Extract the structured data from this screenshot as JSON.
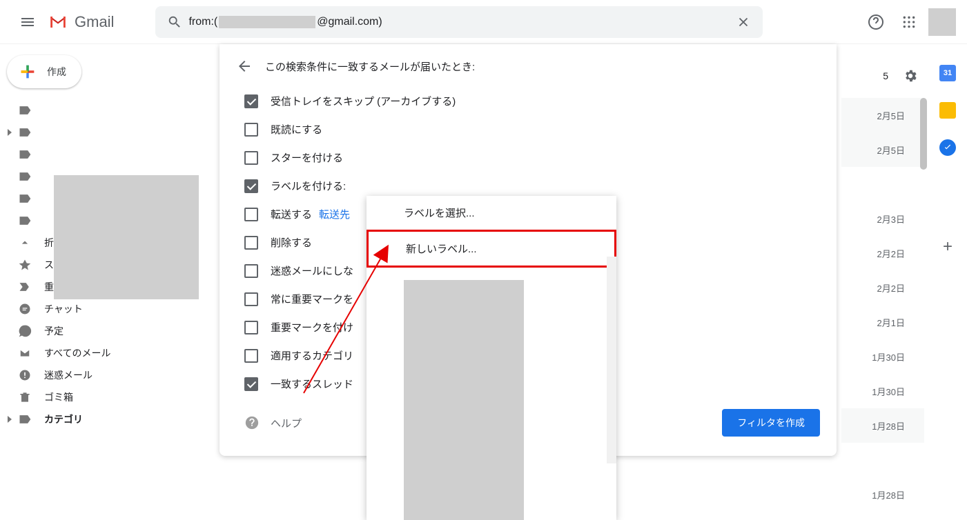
{
  "header": {
    "app_name": "Gmail",
    "search": {
      "prefix": "from:(",
      "suffix": "@gmail.com)",
      "value": "from:(                        @gmail.com)"
    }
  },
  "compose": {
    "label": "作成"
  },
  "sidebar": {
    "items": [
      {
        "icon": "label",
        "label": "",
        "expandable": false
      },
      {
        "icon": "label",
        "label": "",
        "expandable": true
      },
      {
        "icon": "label",
        "label": ""
      },
      {
        "icon": "label",
        "label": ""
      },
      {
        "icon": "label",
        "label": ""
      },
      {
        "icon": "label",
        "label": ""
      },
      {
        "icon": "chevron-up",
        "label": "折りたたむ"
      },
      {
        "icon": "star",
        "label": "スター付き"
      },
      {
        "icon": "important",
        "label": "重要"
      },
      {
        "icon": "chat",
        "label": "チャット"
      },
      {
        "icon": "schedule",
        "label": "予定"
      },
      {
        "icon": "all-mail",
        "label": "すべてのメール"
      },
      {
        "icon": "spam",
        "label": "迷惑メール"
      },
      {
        "icon": "trash",
        "label": "ゴミ箱"
      },
      {
        "icon": "label",
        "label": "カテゴリ",
        "expandable": true,
        "bold": true
      }
    ]
  },
  "toolbar_right": {
    "input_hint_partial": "5",
    "settings": "settings-icon"
  },
  "dates": [
    "2月5日",
    "2月5日",
    "",
    "2月3日",
    "2月2日",
    "2月2日",
    "2月1日",
    "1月30日",
    "1月30日",
    "1月28日",
    "",
    "1月28日"
  ],
  "filter": {
    "title": "この検索条件に一致するメールが届いたとき:",
    "options": [
      {
        "checked": true,
        "label": "受信トレイをスキップ (アーカイブする)"
      },
      {
        "checked": false,
        "label": "既読にする"
      },
      {
        "checked": false,
        "label": "スターを付ける"
      },
      {
        "checked": true,
        "label": "ラベルを付ける:"
      },
      {
        "checked": false,
        "label": "転送する",
        "link": "転送先"
      },
      {
        "checked": false,
        "label": "削除する"
      },
      {
        "checked": false,
        "label": "迷惑メールにしな"
      },
      {
        "checked": false,
        "label": "常に重要マークを"
      },
      {
        "checked": false,
        "label": "重要マークを付け"
      },
      {
        "checked": false,
        "label": "適用するカテゴリ"
      },
      {
        "checked": true,
        "label": "一致するスレッド"
      }
    ],
    "help": "ヘルプ",
    "create_button": "フィルタを作成"
  },
  "label_dropdown": {
    "select_label": "ラベルを選択...",
    "new_label": "新しいラベル..."
  },
  "side_panel": {
    "calendar_day": "31"
  }
}
